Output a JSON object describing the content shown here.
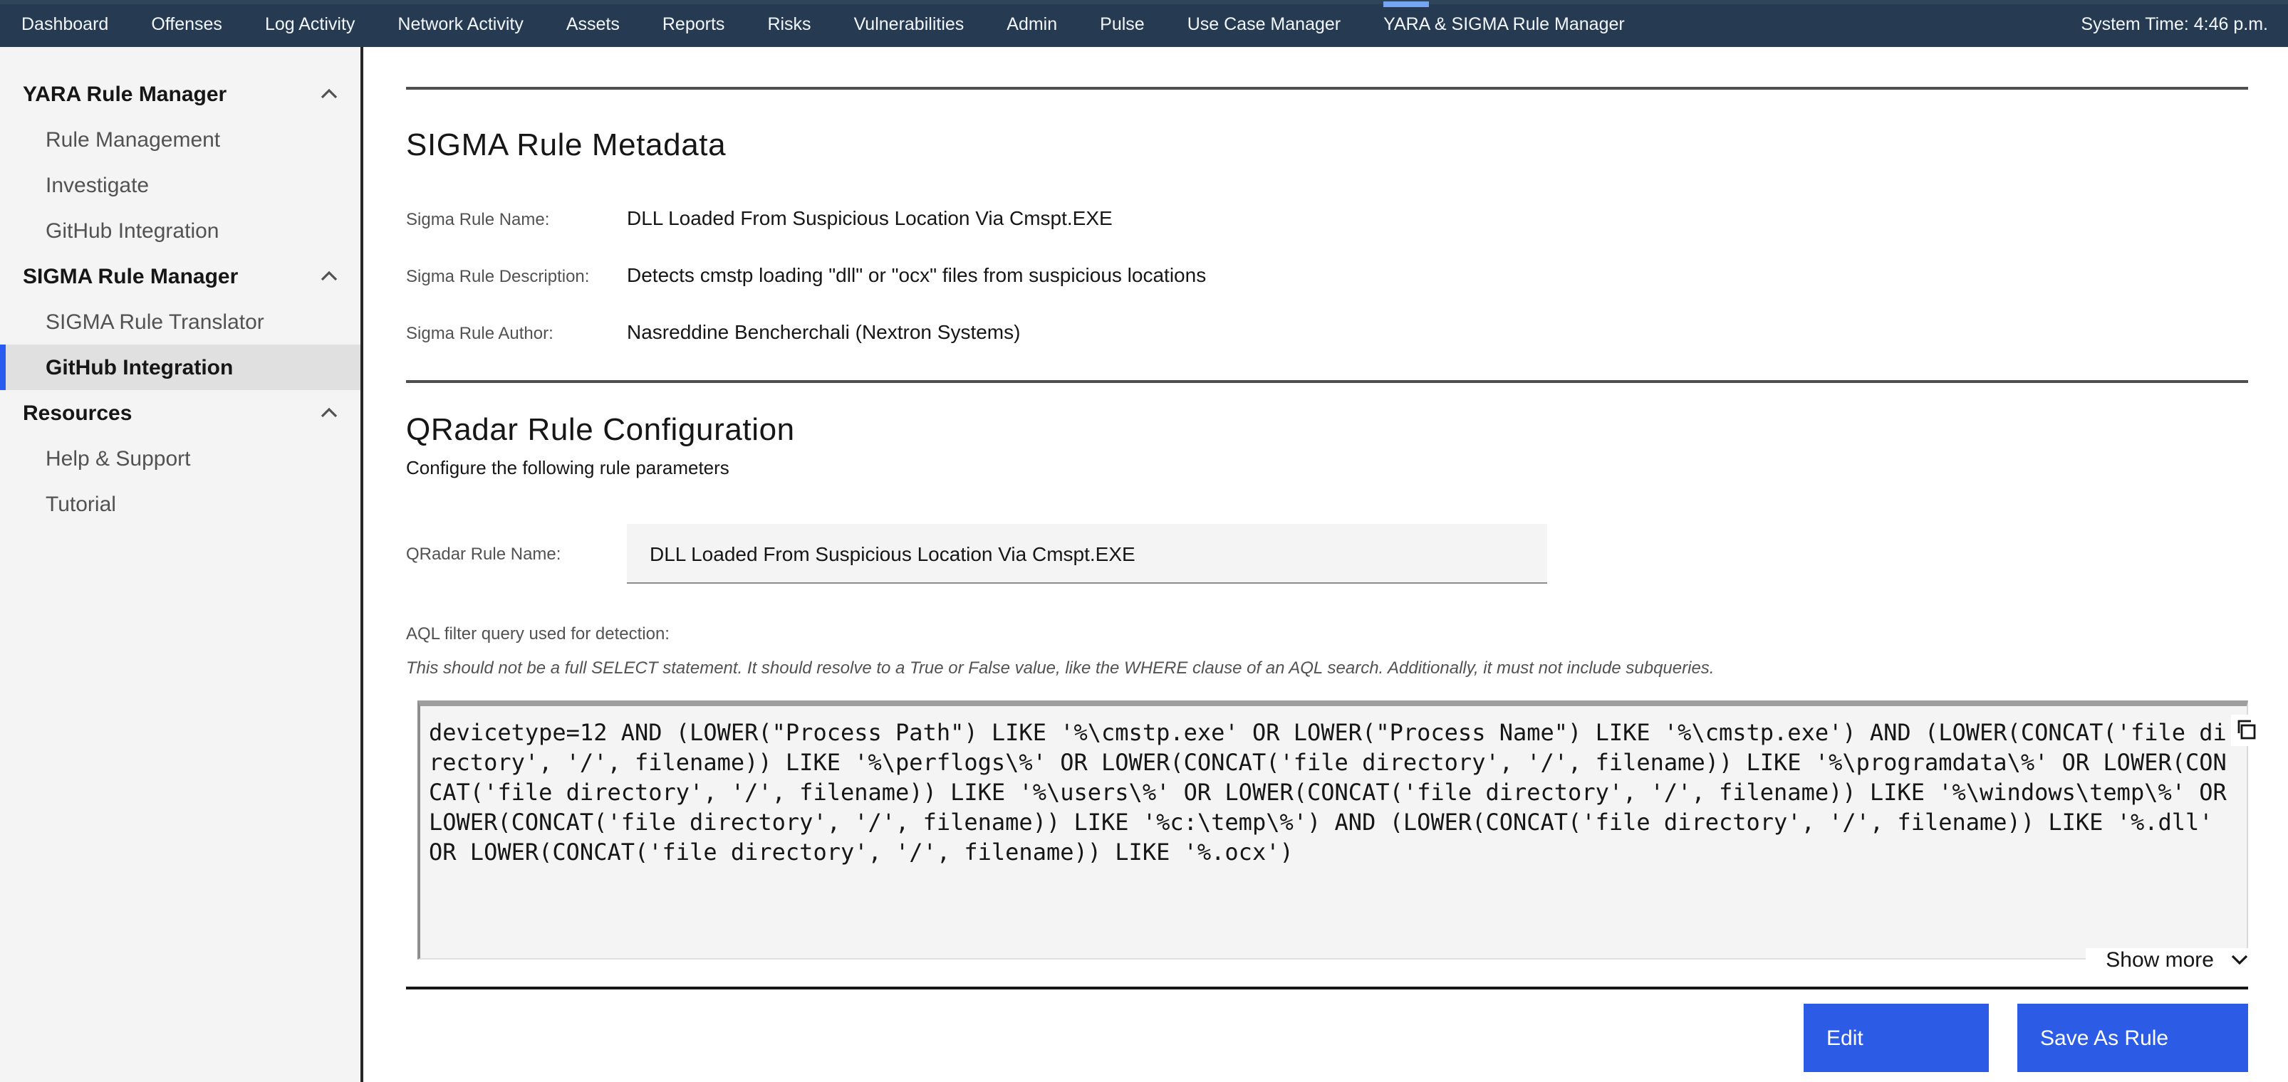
{
  "navbar": {
    "items": [
      {
        "label": "Dashboard"
      },
      {
        "label": "Offenses"
      },
      {
        "label": "Log Activity"
      },
      {
        "label": "Network Activity"
      },
      {
        "label": "Assets"
      },
      {
        "label": "Reports"
      },
      {
        "label": "Risks"
      },
      {
        "label": "Vulnerabilities"
      },
      {
        "label": "Admin"
      },
      {
        "label": "Pulse"
      },
      {
        "label": "Use Case Manager"
      },
      {
        "label": "YARA & SIGMA Rule Manager",
        "active": true
      }
    ],
    "system_time": "System Time: 4:46 p.m.",
    "active_indicator_color": "#74a5f2",
    "background_color": "#263a52"
  },
  "sidebar": {
    "sections": [
      {
        "label": "YARA Rule Manager",
        "expanded": true,
        "items": [
          {
            "label": "Rule Management"
          },
          {
            "label": "Investigate"
          },
          {
            "label": "GitHub Integration"
          }
        ]
      },
      {
        "label": "SIGMA Rule Manager",
        "expanded": true,
        "items": [
          {
            "label": "SIGMA Rule Translator"
          },
          {
            "label": "GitHub Integration",
            "selected": true
          }
        ]
      },
      {
        "label": "Resources",
        "expanded": true,
        "items": [
          {
            "label": "Help & Support"
          },
          {
            "label": "Tutorial"
          }
        ]
      }
    ],
    "selected_bar_color": "#2a5bf0"
  },
  "metadata": {
    "title": "SIGMA Rule Metadata",
    "fields": [
      {
        "label": "Sigma Rule Name:",
        "value": "DLL Loaded From Suspicious Location Via Cmspt.EXE"
      },
      {
        "label": "Sigma Rule Description:",
        "value": "Detects cmstp loading \"dll\" or \"ocx\" files from suspicious locations"
      },
      {
        "label": "Sigma Rule Author:",
        "value": "Nasreddine Bencherchali (Nextron Systems)"
      }
    ]
  },
  "config": {
    "title": "QRadar Rule Configuration",
    "subtitle": "Configure the following rule parameters",
    "rule_name_label": "QRadar Rule Name:",
    "rule_name_value": "DLL Loaded From Suspicious Location Via Cmspt.EXE",
    "aql_label": "AQL filter query used for detection:",
    "aql_note": "This should not be a full SELECT statement. It should resolve to a True or False value, like the WHERE clause of an AQL search. Additionally, it must not include subqueries.",
    "aql_query": "devicetype=12 AND (LOWER(\"Process Path\") LIKE '%\\cmstp.exe' OR LOWER(\"Process Name\") LIKE '%\\cmstp.exe') AND (LOWER(CONCAT('file directory', '/', filename)) LIKE '%\\perflogs\\%' OR LOWER(CONCAT('file directory', '/', filename)) LIKE '%\\programdata\\%' OR LOWER(CONCAT('file directory', '/', filename)) LIKE '%\\users\\%' OR LOWER(CONCAT('file directory', '/', filename)) LIKE '%\\windows\\temp\\%' OR LOWER(CONCAT('file directory', '/', filename)) LIKE '%c:\\temp\\%') AND (LOWER(CONCAT('file directory', '/', filename)) LIKE '%.dll' OR LOWER(CONCAT('file directory', '/', filename)) LIKE '%.ocx')",
    "show_more_label": "Show more",
    "buttons": {
      "edit": "Edit",
      "save": "Save As Rule"
    },
    "button_color": "#2c5ce6"
  }
}
